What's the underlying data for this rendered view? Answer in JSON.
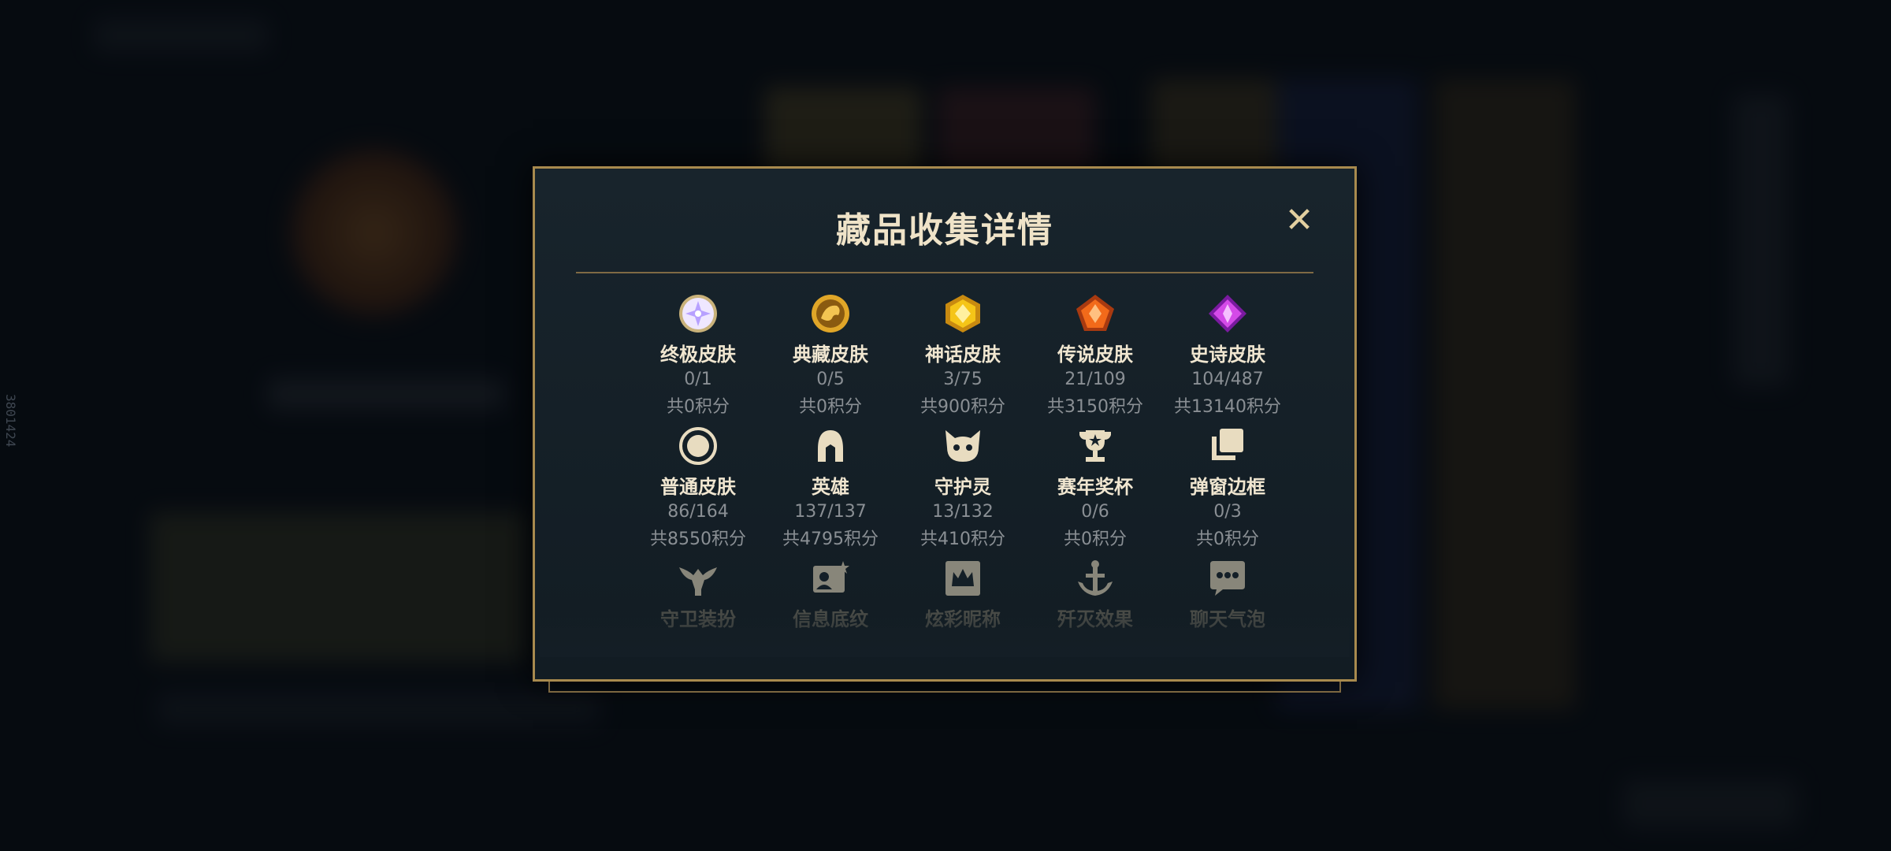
{
  "side_id": "3801424",
  "dialog": {
    "title": "藏品收集详情",
    "close_label": "✕"
  },
  "items": [
    {
      "name": "终极皮肤",
      "count": "0/1",
      "points": "共0积分",
      "icon": "ultimate-gem-icon"
    },
    {
      "name": "典藏皮肤",
      "count": "0/5",
      "points": "共0积分",
      "icon": "prestige-dragon-icon"
    },
    {
      "name": "神话皮肤",
      "count": "3/75",
      "points": "共900积分",
      "icon": "mythic-gem-icon"
    },
    {
      "name": "传说皮肤",
      "count": "21/109",
      "points": "共3150积分",
      "icon": "legendary-gem-icon"
    },
    {
      "name": "史诗皮肤",
      "count": "104/487",
      "points": "共13140积分",
      "icon": "epic-gem-icon"
    },
    {
      "name": "普通皮肤",
      "count": "86/164",
      "points": "共8550积分",
      "icon": "normal-circle-icon"
    },
    {
      "name": "英雄",
      "count": "137/137",
      "points": "共4795积分",
      "icon": "helmet-icon"
    },
    {
      "name": "守护灵",
      "count": "13/132",
      "points": "共410积分",
      "icon": "guardian-pet-icon"
    },
    {
      "name": "赛年奖杯",
      "count": "0/6",
      "points": "共0积分",
      "icon": "trophy-icon"
    },
    {
      "name": "弹窗边框",
      "count": "0/3",
      "points": "共0积分",
      "icon": "frame-stack-icon"
    },
    {
      "name": "守卫装扮",
      "count": "",
      "points": "",
      "icon": "ward-icon"
    },
    {
      "name": "信息底纹",
      "count": "",
      "points": "",
      "icon": "card-banner-icon"
    },
    {
      "name": "炫彩昵称",
      "count": "",
      "points": "",
      "icon": "crown-name-icon"
    },
    {
      "name": "歼灭效果",
      "count": "",
      "points": "",
      "icon": "anchor-icon"
    },
    {
      "name": "聊天气泡",
      "count": "",
      "points": "",
      "icon": "chat-bubble-icon"
    }
  ]
}
